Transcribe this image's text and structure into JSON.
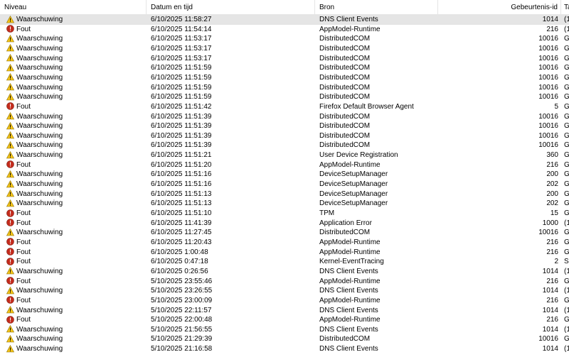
{
  "columns": {
    "level": "Niveau",
    "date": "Datum en tijd",
    "source": "Bron",
    "event_id": "Gebeurtenis-id",
    "task": "Ta"
  },
  "level_icons": {
    "Waarschuwing": "warning-icon",
    "Fout": "error-icon"
  },
  "rows": [
    {
      "level": "Waarschuwing",
      "date": "6/10/2025 11:58:27",
      "source": "DNS Client Events",
      "id": "1014",
      "task": "(1"
    },
    {
      "level": "Fout",
      "date": "6/10/2025 11:54:14",
      "source": "AppModel-Runtime",
      "id": "216",
      "task": "(1"
    },
    {
      "level": "Waarschuwing",
      "date": "6/10/2025 11:53:17",
      "source": "DistributedCOM",
      "id": "10016",
      "task": "G"
    },
    {
      "level": "Waarschuwing",
      "date": "6/10/2025 11:53:17",
      "source": "DistributedCOM",
      "id": "10016",
      "task": "G"
    },
    {
      "level": "Waarschuwing",
      "date": "6/10/2025 11:53:17",
      "source": "DistributedCOM",
      "id": "10016",
      "task": "G"
    },
    {
      "level": "Waarschuwing",
      "date": "6/10/2025 11:51:59",
      "source": "DistributedCOM",
      "id": "10016",
      "task": "G"
    },
    {
      "level": "Waarschuwing",
      "date": "6/10/2025 11:51:59",
      "source": "DistributedCOM",
      "id": "10016",
      "task": "G"
    },
    {
      "level": "Waarschuwing",
      "date": "6/10/2025 11:51:59",
      "source": "DistributedCOM",
      "id": "10016",
      "task": "G"
    },
    {
      "level": "Waarschuwing",
      "date": "6/10/2025 11:51:59",
      "source": "DistributedCOM",
      "id": "10016",
      "task": "G"
    },
    {
      "level": "Fout",
      "date": "6/10/2025 11:51:42",
      "source": "Firefox Default Browser Agent",
      "id": "5",
      "task": "G"
    },
    {
      "level": "Waarschuwing",
      "date": "6/10/2025 11:51:39",
      "source": "DistributedCOM",
      "id": "10016",
      "task": "G"
    },
    {
      "level": "Waarschuwing",
      "date": "6/10/2025 11:51:39",
      "source": "DistributedCOM",
      "id": "10016",
      "task": "G"
    },
    {
      "level": "Waarschuwing",
      "date": "6/10/2025 11:51:39",
      "source": "DistributedCOM",
      "id": "10016",
      "task": "G"
    },
    {
      "level": "Waarschuwing",
      "date": "6/10/2025 11:51:39",
      "source": "DistributedCOM",
      "id": "10016",
      "task": "G"
    },
    {
      "level": "Waarschuwing",
      "date": "6/10/2025 11:51:21",
      "source": "User Device Registration",
      "id": "360",
      "task": "G"
    },
    {
      "level": "Fout",
      "date": "6/10/2025 11:51:20",
      "source": "AppModel-Runtime",
      "id": "216",
      "task": "G"
    },
    {
      "level": "Waarschuwing",
      "date": "6/10/2025 11:51:16",
      "source": "DeviceSetupManager",
      "id": "200",
      "task": "G"
    },
    {
      "level": "Waarschuwing",
      "date": "6/10/2025 11:51:16",
      "source": "DeviceSetupManager",
      "id": "202",
      "task": "G"
    },
    {
      "level": "Waarschuwing",
      "date": "6/10/2025 11:51:13",
      "source": "DeviceSetupManager",
      "id": "200",
      "task": "G"
    },
    {
      "level": "Waarschuwing",
      "date": "6/10/2025 11:51:13",
      "source": "DeviceSetupManager",
      "id": "202",
      "task": "G"
    },
    {
      "level": "Fout",
      "date": "6/10/2025 11:51:10",
      "source": "TPM",
      "id": "15",
      "task": "G"
    },
    {
      "level": "Fout",
      "date": "6/10/2025 11:41:39",
      "source": "Application Error",
      "id": "1000",
      "task": "(1"
    },
    {
      "level": "Waarschuwing",
      "date": "6/10/2025 11:27:45",
      "source": "DistributedCOM",
      "id": "10016",
      "task": "G"
    },
    {
      "level": "Fout",
      "date": "6/10/2025 11:20:43",
      "source": "AppModel-Runtime",
      "id": "216",
      "task": "G"
    },
    {
      "level": "Fout",
      "date": "6/10/2025 1:00:48",
      "source": "AppModel-Runtime",
      "id": "216",
      "task": "G"
    },
    {
      "level": "Fout",
      "date": "6/10/2025 0:47:18",
      "source": "Kernel-EventTracing",
      "id": "2",
      "task": "Se"
    },
    {
      "level": "Waarschuwing",
      "date": "6/10/2025 0:26:56",
      "source": "DNS Client Events",
      "id": "1014",
      "task": "(1"
    },
    {
      "level": "Fout",
      "date": "5/10/2025 23:55:46",
      "source": "AppModel-Runtime",
      "id": "216",
      "task": "G"
    },
    {
      "level": "Waarschuwing",
      "date": "5/10/2025 23:26:55",
      "source": "DNS Client Events",
      "id": "1014",
      "task": "(1"
    },
    {
      "level": "Fout",
      "date": "5/10/2025 23:00:09",
      "source": "AppModel-Runtime",
      "id": "216",
      "task": "G"
    },
    {
      "level": "Waarschuwing",
      "date": "5/10/2025 22:11:57",
      "source": "DNS Client Events",
      "id": "1014",
      "task": "(1"
    },
    {
      "level": "Fout",
      "date": "5/10/2025 22:00:48",
      "source": "AppModel-Runtime",
      "id": "216",
      "task": "G"
    },
    {
      "level": "Waarschuwing",
      "date": "5/10/2025 21:56:55",
      "source": "DNS Client Events",
      "id": "1014",
      "task": "(1"
    },
    {
      "level": "Waarschuwing",
      "date": "5/10/2025 21:29:39",
      "source": "DistributedCOM",
      "id": "10016",
      "task": "G"
    },
    {
      "level": "Waarschuwing",
      "date": "5/10/2025 21:16:58",
      "source": "DNS Client Events",
      "id": "1014",
      "task": "(1"
    }
  ],
  "colors": {
    "warning": "#f5c518",
    "error": "#c42b1c",
    "selected_row": "#e5e5e5"
  }
}
